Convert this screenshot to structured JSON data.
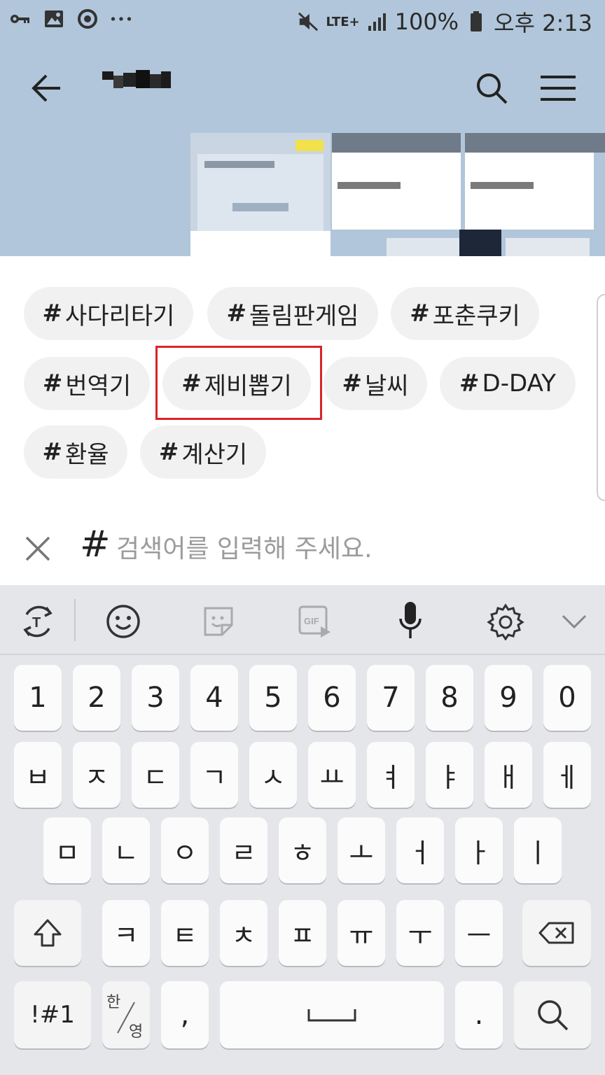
{
  "status_bar": {
    "battery": "100%",
    "network": "LTE+",
    "time": "오후 2:13"
  },
  "header": {
    "back_icon": "back-arrow-icon",
    "search_icon": "search-icon",
    "menu_icon": "hamburger-menu-icon"
  },
  "tags": [
    {
      "label": "사다리타기"
    },
    {
      "label": "돌림판게임"
    },
    {
      "label": "포춘쿠키"
    },
    {
      "label": "번역기"
    },
    {
      "label": "제비뽑기"
    },
    {
      "label": "날씨"
    },
    {
      "label": "D-DAY"
    },
    {
      "label": "환율"
    },
    {
      "label": "계산기"
    }
  ],
  "tag_prefix": "#",
  "search": {
    "hash": "#",
    "placeholder": "검색어를 입력해 주세요."
  },
  "keyboard": {
    "number_row": [
      "1",
      "2",
      "3",
      "4",
      "5",
      "6",
      "7",
      "8",
      "9",
      "0"
    ],
    "row1": [
      "ㅂ",
      "ㅈ",
      "ㄷ",
      "ㄱ",
      "ㅅ",
      "ㅛ",
      "ㅕ",
      "ㅑ",
      "ㅐ",
      "ㅔ"
    ],
    "row2": [
      "ㅁ",
      "ㄴ",
      "ㅇ",
      "ㄹ",
      "ㅎ",
      "ㅗ",
      "ㅓ",
      "ㅏ",
      "ㅣ"
    ],
    "row3": [
      "ㅋ",
      "ㅌ",
      "ㅊ",
      "ㅍ",
      "ㅠ",
      "ㅜ",
      "ㅡ"
    ],
    "symbols_key": "!#1",
    "lang_key_top": "한",
    "lang_key_bottom": "영",
    "comma_key": ",",
    "period_key": ".",
    "colors": {
      "accent": "#d9242b",
      "header_bg": "#b1c6da",
      "keyboard_bg": "#e4e6ea"
    }
  }
}
